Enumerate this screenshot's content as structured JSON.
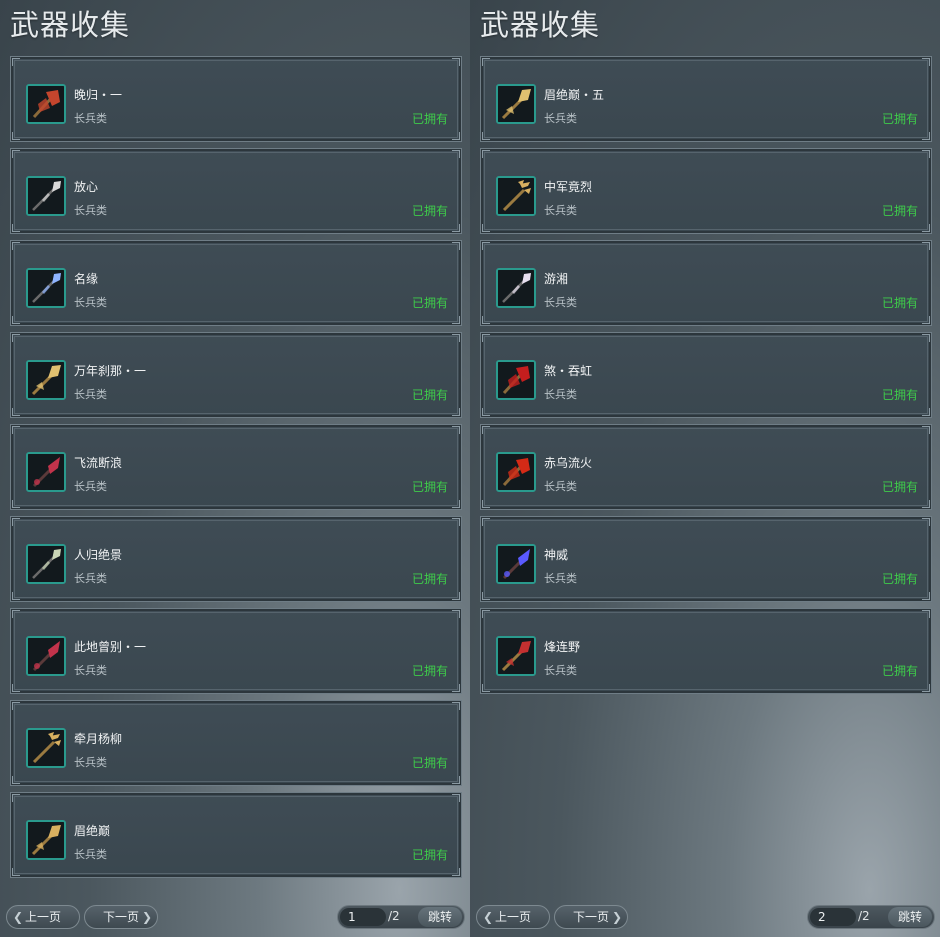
{
  "left": {
    "title": "武器收集",
    "items": [
      {
        "name": "晚归・一",
        "type": "长兵类",
        "status": "已拥有",
        "icon": "axe-weapon-icon",
        "color": "#c4452d"
      },
      {
        "name": "放心",
        "type": "长兵类",
        "status": "已拥有",
        "icon": "spear-weapon-icon",
        "color": "#d9d9d9"
      },
      {
        "name": "名缘",
        "type": "长兵类",
        "status": "已拥有",
        "icon": "spear-weapon-icon",
        "color": "#8fb4ff"
      },
      {
        "name": "万年刹那・一",
        "type": "长兵类",
        "status": "已拥有",
        "icon": "halberd-weapon-icon",
        "color": "#e0c070"
      },
      {
        "name": "飞流断浪",
        "type": "长兵类",
        "status": "已拥有",
        "icon": "blade-weapon-icon",
        "color": "#c2334b"
      },
      {
        "name": "人归绝景",
        "type": "长兵类",
        "status": "已拥有",
        "icon": "spear-weapon-icon",
        "color": "#c9d6b6"
      },
      {
        "name": "此地曾别・一",
        "type": "长兵类",
        "status": "已拥有",
        "icon": "blade-weapon-icon",
        "color": "#c2334b"
      },
      {
        "name": "牵月杨柳",
        "type": "长兵类",
        "status": "已拥有",
        "icon": "trident-weapon-icon",
        "color": "#d8b060"
      },
      {
        "name": "眉绝巅",
        "type": "长兵类",
        "status": "已拥有",
        "icon": "halberd-weapon-icon",
        "color": "#d8b060"
      }
    ],
    "pager": {
      "prev": "上一页",
      "next": "下一页",
      "page": "1",
      "total": "/2",
      "jump": "跳转"
    }
  },
  "right": {
    "title": "武器收集",
    "items": [
      {
        "name": "眉绝巅・五",
        "type": "长兵类",
        "status": "已拥有",
        "icon": "halberd-weapon-icon",
        "color": "#e0c070"
      },
      {
        "name": "中军竟烈",
        "type": "长兵类",
        "status": "已拥有",
        "icon": "trident-weapon-icon",
        "color": "#d8b060"
      },
      {
        "name": "游湘",
        "type": "长兵类",
        "status": "已拥有",
        "icon": "spear-weapon-icon",
        "color": "#e8e0f0"
      },
      {
        "name": "煞・吞虹",
        "type": "长兵类",
        "status": "已拥有",
        "icon": "axe-weapon-icon",
        "color": "#c41e1e"
      },
      {
        "name": "赤乌流火",
        "type": "长兵类",
        "status": "已拥有",
        "icon": "axe-weapon-icon",
        "color": "#d42a16"
      },
      {
        "name": "神威",
        "type": "长兵类",
        "status": "已拥有",
        "icon": "blade-weapon-icon",
        "color": "#5a5aff"
      },
      {
        "name": "烽连野",
        "type": "长兵类",
        "status": "已拥有",
        "icon": "halberd-weapon-icon",
        "color": "#c43030"
      }
    ],
    "pager": {
      "prev": "上一页",
      "next": "下一页",
      "page": "2",
      "total": "/2",
      "jump": "跳转"
    }
  }
}
